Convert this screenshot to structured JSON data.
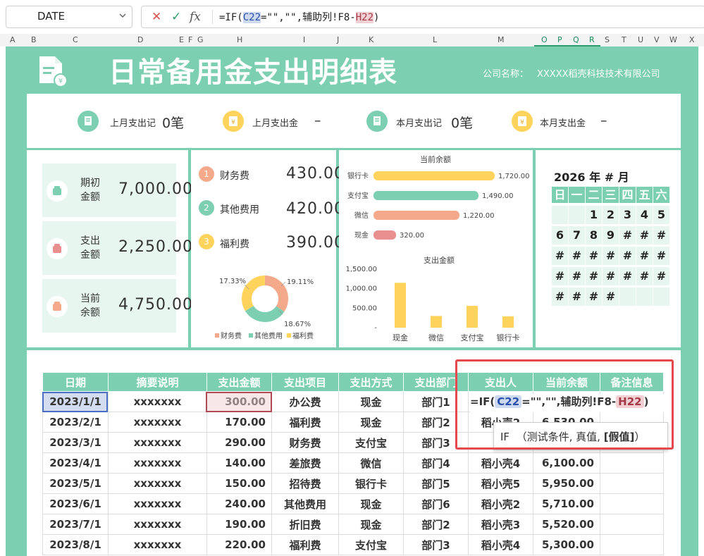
{
  "formula_bar": {
    "name_box": "DATE",
    "formula_pre": "=IF(",
    "ref1": "C22",
    "formula_mid": "=\"\",\"\",辅助列!F8-",
    "ref2": "H22",
    "formula_post": ")"
  },
  "columns": [
    "A",
    "B",
    "C",
    "D",
    "E",
    "F",
    "G",
    "H",
    "I",
    "J",
    "K",
    "L",
    "M",
    "O",
    "P",
    "Q",
    "R",
    "S",
    "T",
    "U",
    "V",
    "W",
    "X"
  ],
  "title": "日常备用金支出明细表",
  "company": {
    "label": "公司名称：",
    "value": "XXXXX稻壳科技技术有限公司"
  },
  "kpis": [
    {
      "label": "上月支出记",
      "value": "0笔",
      "color": "#7ccfb0",
      "icon": "receipt-icon"
    },
    {
      "label": "上月支出金",
      "value": "–",
      "color": "#ffd35c",
      "icon": "money-icon"
    },
    {
      "label": "本月支出记",
      "value": "0笔",
      "color": "#7ccfb0",
      "icon": "receipt-icon"
    },
    {
      "label": "本月支出金",
      "value": "–",
      "color": "#ffd35c",
      "icon": "money-icon"
    }
  ],
  "balance_cards": [
    {
      "label": "期初金额",
      "value": "7,000.00",
      "color": "#7ccfb0"
    },
    {
      "label": "支出金额",
      "value": "2,250.00",
      "color": "#ea8f8f"
    },
    {
      "label": "当前余额",
      "value": "4,750.00",
      "color": "#f3a98a"
    }
  ],
  "categories": [
    {
      "num": "1",
      "label": "财务费",
      "value": "430.00",
      "color": "#f3a98a"
    },
    {
      "num": "2",
      "label": "其他费用",
      "value": "420.00",
      "color": "#7ccfb0"
    },
    {
      "num": "3",
      "label": "福利费",
      "value": "390.00",
      "color": "#ffd35c"
    }
  ],
  "donut": {
    "labels": [
      "17.33%",
      "19.11%",
      "18.67%"
    ],
    "legend": [
      "财务费",
      "其他费用",
      "福利费"
    ]
  },
  "chart_data": [
    {
      "type": "bar",
      "orientation": "horizontal",
      "title": "当前余额",
      "categories": [
        "银行卡",
        "支付宝",
        "微信",
        "现金"
      ],
      "values": [
        1720,
        1490,
        1220,
        320
      ],
      "value_labels": [
        "1,720.00",
        "1,490.00",
        "1,220.00",
        "320.00"
      ],
      "colors": [
        "#ffd35c",
        "#7ccfb0",
        "#f3a98a",
        "#ea8f8f"
      ]
    },
    {
      "type": "bar",
      "title": "支出金额",
      "categories": [
        "现金",
        "微信",
        "支付宝",
        "银行卡"
      ],
      "values": [
        1150,
        300,
        560,
        290
      ],
      "ylim": [
        0,
        1500
      ],
      "yticks": [
        "1,500.00",
        "1,000.00",
        "500.00",
        "-"
      ],
      "color": "#ffd35c"
    }
  ],
  "calendar": {
    "year": "2026",
    "year_unit": "年",
    "month": "#",
    "month_unit": "月",
    "weekdays": [
      "日",
      "一",
      "二",
      "三",
      "四",
      "五",
      "六"
    ],
    "weeks": [
      [
        "",
        "",
        "1",
        "2",
        "3",
        "4",
        "5"
      ],
      [
        "6",
        "7",
        "8",
        "9",
        "#",
        "#",
        "#"
      ],
      [
        "#",
        "#",
        "#",
        "#",
        "#",
        "#",
        "#"
      ],
      [
        "#",
        "#",
        "#",
        "#",
        "#",
        "#",
        "#"
      ],
      [
        "#",
        "#",
        "#",
        "#",
        "",
        "",
        ""
      ]
    ]
  },
  "table": {
    "headers": [
      "日期",
      "摘要说明",
      "支出金额",
      "支出项目",
      "支出方式",
      "支出部门",
      "支出人",
      "当前余额",
      "备注信息"
    ],
    "rows": [
      [
        "2023/1/1",
        "xxxxxxx",
        "300.00",
        "办公费",
        "现金",
        "部门1",
        "",
        "",
        ""
      ],
      [
        "2023/2/1",
        "xxxxxxx",
        "170.00",
        "福利费",
        "现金",
        "部门2",
        "稻小壳2",
        "6,530.00",
        ""
      ],
      [
        "2023/3/1",
        "xxxxxxx",
        "290.00",
        "财务费",
        "支付宝",
        "部门3",
        "稻",
        "",
        ""
      ],
      [
        "2023/4/1",
        "xxxxxxx",
        "140.00",
        "差旅费",
        "微信",
        "部门4",
        "稻小壳4",
        "6,100.00",
        ""
      ],
      [
        "2023/5/1",
        "xxxxxxx",
        "150.00",
        "招待费",
        "银行卡",
        "部门5",
        "稻小壳5",
        "5,950.00",
        ""
      ],
      [
        "2023/6/1",
        "xxxxxxx",
        "240.00",
        "其他费用",
        "现金",
        "部门6",
        "稻小壳2",
        "5,710.00",
        ""
      ],
      [
        "2023/7/1",
        "xxxxxxx",
        "190.00",
        "折旧费",
        "现金",
        "部门2",
        "稻小壳3",
        "5,520.00",
        ""
      ],
      [
        "2023/8/1",
        "xxxxxxx",
        "220.00",
        "福利费",
        "支付宝",
        "部门3",
        "稻小壳4",
        "5,300.00",
        ""
      ]
    ]
  },
  "incell_formula": {
    "pre": "=IF(",
    "ref1": "C22",
    "mid": "=\"\",\"\",辅助列!F8-",
    "ref2": "H22",
    "post": ")"
  },
  "tooltip": {
    "func": "IF",
    "args": "（测试条件, 真值,",
    "current_arg": "[假值]",
    "close": "）"
  }
}
